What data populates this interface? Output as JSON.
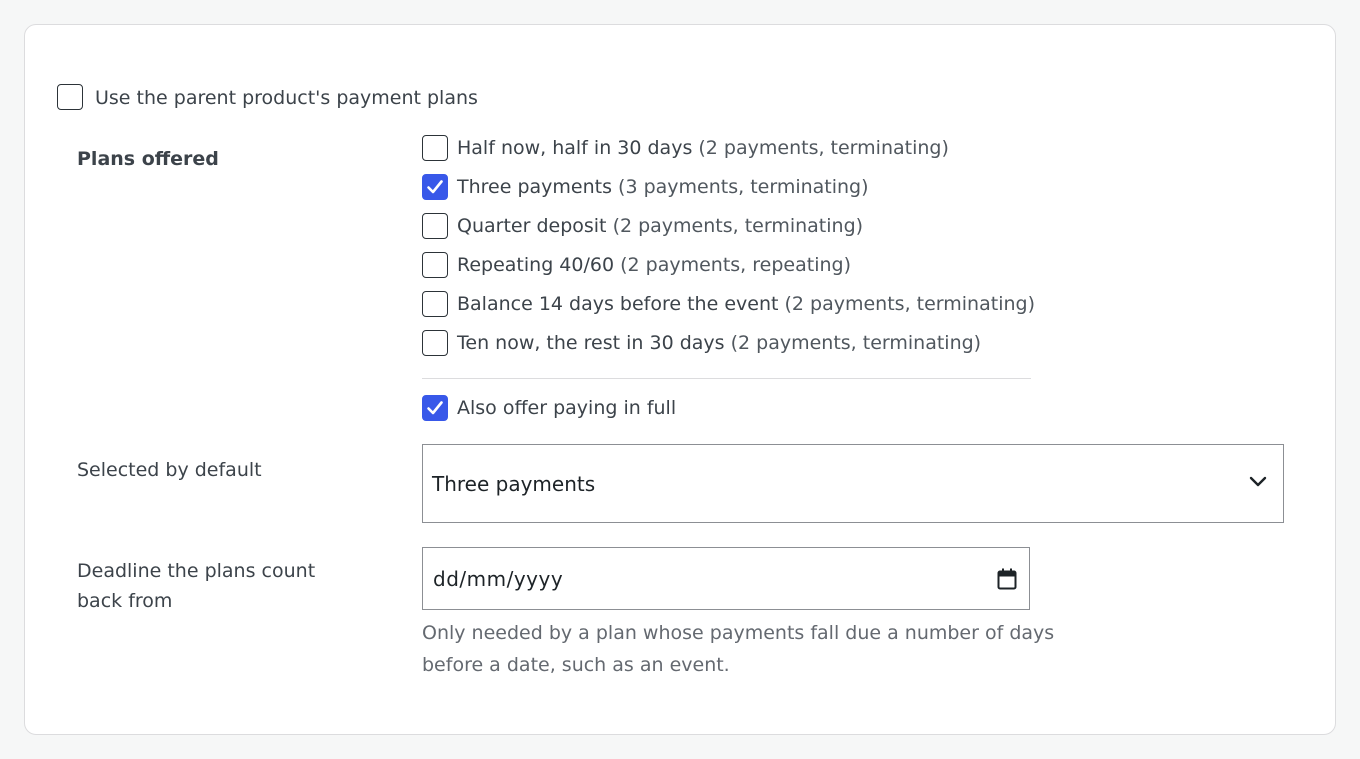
{
  "use_parent": {
    "label": "Use the parent product's payment plans",
    "checked": false
  },
  "plans_offered": {
    "label": "Plans offered",
    "plans": [
      {
        "name": "Half now, half in 30 days",
        "detail": "(2 payments, terminating)",
        "checked": false
      },
      {
        "name": "Three payments",
        "detail": "(3 payments, terminating)",
        "checked": true
      },
      {
        "name": "Quarter deposit",
        "detail": "(2 payments, terminating)",
        "checked": false
      },
      {
        "name": "Repeating 40/60",
        "detail": "(2 payments, repeating)",
        "checked": false
      },
      {
        "name": "Balance 14 days before the event",
        "detail": "(2 payments, terminating)",
        "checked": false
      },
      {
        "name": "Ten now, the rest in 30 days",
        "detail": "(2 payments, terminating)",
        "checked": false
      }
    ],
    "pay_in_full": {
      "label": "Also offer paying in full",
      "checked": true
    }
  },
  "default_plan": {
    "label": "Selected by default",
    "selected": "Three payments"
  },
  "deadline": {
    "label_line1": "Deadline the plans count",
    "label_line2": "back from",
    "placeholder": "dd/mm/yyyy",
    "help": "Only needed by a plan whose payments fall due a number of days before a date, such as an event."
  },
  "colors": {
    "accent": "#3858e9",
    "border": "#dcdcde"
  },
  "icons": {
    "select": "chevron-down-icon",
    "date": "calendar-icon",
    "check": "checkmark-icon"
  }
}
